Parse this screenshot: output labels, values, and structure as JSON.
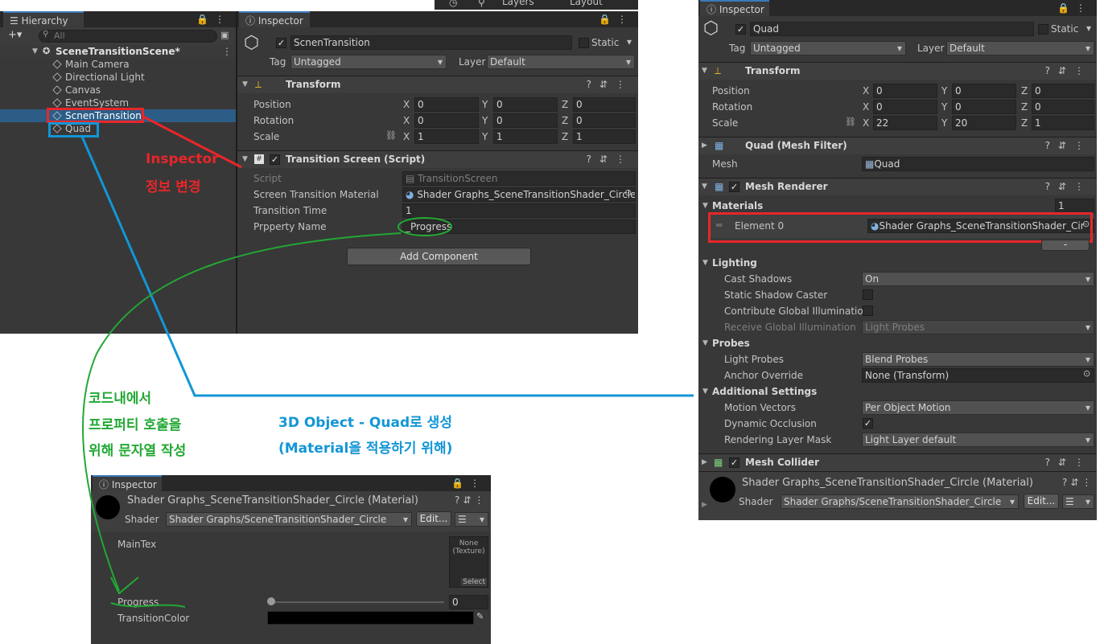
{
  "hierarchy": {
    "tab_label": "Hierarchy",
    "add_label": "+▾",
    "search_placeholder": "All",
    "scene_name": "SceneTransitionScene*",
    "items": [
      {
        "label": "Main Camera"
      },
      {
        "label": "Directional Light"
      },
      {
        "label": "Canvas"
      },
      {
        "label": "EventSystem"
      },
      {
        "label": "ScnenTransition"
      },
      {
        "label": "Quad"
      }
    ]
  },
  "top_toolbar": {
    "layers_label": "Layers",
    "layout_label": "Layout"
  },
  "inspector1": {
    "tab_label": "Inspector",
    "object_name": "ScnenTransition",
    "static_label": "Static",
    "tag_label": "Tag",
    "tag_value": "Untagged",
    "layer_label": "Layer",
    "layer_value": "Default",
    "transform": {
      "title": "Transform",
      "position_label": "Position",
      "rotation_label": "Rotation",
      "scale_label": "Scale",
      "position": [
        "0",
        "0",
        "0"
      ],
      "rotation": [
        "0",
        "0",
        "0"
      ],
      "scale": [
        "1",
        "1",
        "1"
      ]
    },
    "script_component": {
      "title": "Transition Screen (Script)",
      "script_label": "Script",
      "script_value": "TransitionScreen",
      "material_label": "Screen Transition Material",
      "material_value": "Shader Graphs_SceneTransitionShader_Circle",
      "time_label": "Transition Time",
      "time_value": "1",
      "property_label": "Prpperty Name",
      "property_value": "_Progress"
    },
    "add_component_label": "Add Component"
  },
  "inspector2": {
    "tab_label": "Inspector",
    "object_name": "Quad",
    "static_label": "Static",
    "tag_label": "Tag",
    "tag_value": "Untagged",
    "layer_label": "Layer",
    "layer_value": "Default",
    "transform": {
      "title": "Transform",
      "position_label": "Position",
      "rotation_label": "Rotation",
      "scale_label": "Scale",
      "position": [
        "0",
        "0",
        "0"
      ],
      "rotation": [
        "0",
        "0",
        "0"
      ],
      "scale": [
        "22",
        "20",
        "1"
      ]
    },
    "mesh_filter": {
      "title": "Quad (Mesh Filter)",
      "mesh_label": "Mesh",
      "mesh_value": "Quad"
    },
    "mesh_renderer": {
      "title": "Mesh Renderer",
      "materials_label": "Materials",
      "materials_count": "1",
      "element_label": "Element 0",
      "element_value": "Shader Graphs_SceneTransitionShader_Cir",
      "lighting_label": "Lighting",
      "cast_shadows_label": "Cast Shadows",
      "cast_shadows_value": "On",
      "static_caster_label": "Static Shadow Caster",
      "contribute_gi_label": "Contribute Global Illumination",
      "receive_gi_label": "Receive Global Illumination",
      "receive_gi_value": "Light Probes",
      "probes_label": "Probes",
      "light_probes_label": "Light Probes",
      "light_probes_value": "Blend Probes",
      "anchor_label": "Anchor Override",
      "anchor_value": "None (Transform)",
      "additional_label": "Additional Settings",
      "motion_label": "Motion Vectors",
      "motion_value": "Per Object Motion",
      "occlusion_label": "Dynamic Occlusion",
      "layer_mask_label": "Rendering Layer Mask",
      "layer_mask_value": "Light Layer default"
    },
    "mesh_collider": {
      "title": "Mesh Collider"
    },
    "material": {
      "title": "Shader Graphs_SceneTransitionShader_Circle (Material)",
      "shader_label": "Shader",
      "shader_value": "Shader Graphs/SceneTransitionShader_Circle",
      "edit_label": "Edit..."
    }
  },
  "inspector3": {
    "tab_label": "Inspector",
    "material_title": "Shader Graphs_SceneTransitionShader_Circle (Material)",
    "shader_label": "Shader",
    "shader_value": "Shader Graphs/SceneTransitionShader_Circle",
    "edit_label": "Edit...",
    "maintex_label": "MainTex",
    "texture_none": "None",
    "texture_type": "(Texture)",
    "select_label": "Select",
    "progress_label": "Progress",
    "progress_value": "0",
    "progress_fraction": 0,
    "color_label": "TransitionColor",
    "color_value": "#000000"
  },
  "annotations": {
    "red_line1": "Inspector",
    "red_line2": "정보 변경",
    "green_line1": "코드내에서",
    "green_line2": "프로퍼티 호출을",
    "green_line3": "위해 문자열 작성",
    "blue_line1": "3D Object - Quad로 생성",
    "blue_line2": "(Material을 적용하기 위해)"
  },
  "colors": {
    "annotation_red": "#e8262a",
    "annotation_green": "#22a834",
    "annotation_blue": "#1296d6",
    "selection": "#2c5d87",
    "panel": "#383838"
  }
}
